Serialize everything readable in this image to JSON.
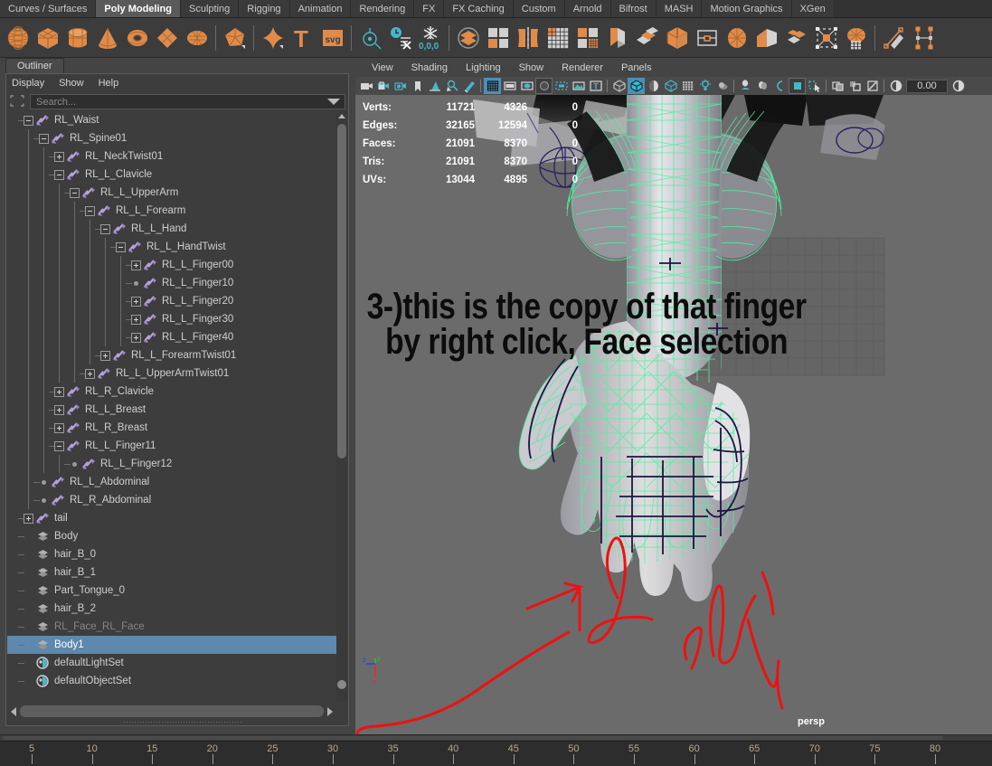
{
  "shelf_tabs": [
    {
      "label": "Curves / Surfaces",
      "active": false
    },
    {
      "label": "Poly Modeling",
      "active": true
    },
    {
      "label": "Sculpting",
      "active": false
    },
    {
      "label": "Rigging",
      "active": false
    },
    {
      "label": "Animation",
      "active": false
    },
    {
      "label": "Rendering",
      "active": false
    },
    {
      "label": "FX",
      "active": false
    },
    {
      "label": "FX Caching",
      "active": false
    },
    {
      "label": "Custom",
      "active": false
    },
    {
      "label": "Arnold",
      "active": false
    },
    {
      "label": "Bifrost",
      "active": false
    },
    {
      "label": "MASH",
      "active": false
    },
    {
      "label": "Motion Graphics",
      "active": false
    },
    {
      "label": "XGen",
      "active": false
    }
  ],
  "shelf_icons": [
    {
      "name": "poly-sphere-icon"
    },
    {
      "name": "poly-cube-icon"
    },
    {
      "name": "poly-cylinder-icon"
    },
    {
      "name": "poly-cone-icon"
    },
    {
      "name": "poly-torus-icon"
    },
    {
      "name": "poly-plane-icon"
    },
    {
      "name": "poly-disc-icon"
    },
    {
      "sep": true
    },
    {
      "name": "poly-platonic-icon"
    },
    {
      "sep": true
    },
    {
      "name": "poly-super-shape-icon"
    },
    {
      "name": "poly-type-text-icon"
    },
    {
      "name": "poly-svg-icon"
    },
    {
      "sep": true
    },
    {
      "name": "sculpt-target-icon"
    },
    {
      "name": "history-clock-icon"
    },
    {
      "name": "freeze-transform-icon"
    },
    {
      "sep": true
    },
    {
      "name": "combine-icon"
    },
    {
      "name": "separate-icon"
    },
    {
      "name": "mirror-icon"
    },
    {
      "name": "smooth-icon"
    },
    {
      "name": "retopologize-icon"
    },
    {
      "name": "extrude-icon"
    },
    {
      "name": "bevel-icon"
    },
    {
      "name": "bridge-icon"
    },
    {
      "name": "fill-hole-icon"
    },
    {
      "name": "circularize-icon"
    },
    {
      "name": "append-polygon-icon"
    },
    {
      "name": "merge-icon"
    },
    {
      "name": "target-weld-icon"
    },
    {
      "name": "multi-cut-icon"
    },
    {
      "sep": true
    },
    {
      "name": "knife-cut-icon"
    },
    {
      "name": "insert-edge-loop-icon"
    }
  ],
  "outliner": {
    "tab_label": "Outliner",
    "menus": [
      "Display",
      "Show",
      "Help"
    ],
    "search_placeholder": "Search...",
    "tree": [
      {
        "label": "RL_Waist",
        "depth": 1,
        "icon": "joint",
        "state": "minus"
      },
      {
        "label": "RL_Spine01",
        "depth": 2,
        "icon": "joint",
        "state": "minus"
      },
      {
        "label": "RL_NeckTwist01",
        "depth": 3,
        "icon": "joint",
        "state": "plus"
      },
      {
        "label": "RL_L_Clavicle",
        "depth": 3,
        "icon": "joint",
        "state": "minus"
      },
      {
        "label": "RL_L_UpperArm",
        "depth": 4,
        "icon": "joint",
        "state": "minus"
      },
      {
        "label": "RL_L_Forearm",
        "depth": 5,
        "icon": "joint",
        "state": "minus"
      },
      {
        "label": "RL_L_Hand",
        "depth": 6,
        "icon": "joint",
        "state": "minus"
      },
      {
        "label": "RL_L_HandTwist",
        "depth": 7,
        "icon": "joint",
        "state": "minus"
      },
      {
        "label": "RL_L_Finger00",
        "depth": 8,
        "icon": "joint",
        "state": "plus"
      },
      {
        "label": "RL_L_Finger10",
        "depth": 8,
        "icon": "joint",
        "state": "leaf"
      },
      {
        "label": "RL_L_Finger20",
        "depth": 8,
        "icon": "joint",
        "state": "plus"
      },
      {
        "label": "RL_L_Finger30",
        "depth": 8,
        "icon": "joint",
        "state": "plus"
      },
      {
        "label": "RL_L_Finger40",
        "depth": 8,
        "icon": "joint",
        "state": "plus"
      },
      {
        "label": "RL_L_ForearmTwist01",
        "depth": 6,
        "icon": "joint",
        "state": "plus"
      },
      {
        "label": "RL_L_UpperArmTwist01",
        "depth": 5,
        "icon": "joint",
        "state": "plus"
      },
      {
        "label": "RL_R_Clavicle",
        "depth": 3,
        "icon": "joint",
        "state": "plus"
      },
      {
        "label": "RL_L_Breast",
        "depth": 3,
        "icon": "joint",
        "state": "plus"
      },
      {
        "label": "RL_R_Breast",
        "depth": 3,
        "icon": "joint",
        "state": "plus"
      },
      {
        "label": "RL_L_Finger11",
        "depth": 3,
        "icon": "joint",
        "state": "minus"
      },
      {
        "label": "RL_L_Finger12",
        "depth": 4,
        "icon": "joint",
        "state": "leaf"
      },
      {
        "label": "RL_L_Abdominal",
        "depth": 2,
        "icon": "joint",
        "state": "leaf"
      },
      {
        "label": "RL_R_Abdominal",
        "depth": 2,
        "icon": "joint",
        "state": "leaf"
      },
      {
        "label": "tail",
        "depth": 1,
        "icon": "joint",
        "state": "plus"
      },
      {
        "label": "Body",
        "depth": 1,
        "icon": "mesh",
        "state": "none"
      },
      {
        "label": "hair_B_0",
        "depth": 1,
        "icon": "mesh",
        "state": "none"
      },
      {
        "label": "hair_B_1",
        "depth": 1,
        "icon": "mesh",
        "state": "none"
      },
      {
        "label": "Part_Tongue_0",
        "depth": 1,
        "icon": "mesh",
        "state": "none"
      },
      {
        "label": "hair_B_2",
        "depth": 1,
        "icon": "mesh",
        "state": "none"
      },
      {
        "label": "RL_Face_RL_Face",
        "depth": 1,
        "icon": "mesh",
        "state": "none",
        "dim": true
      },
      {
        "label": "Body1",
        "depth": 1,
        "icon": "mesh",
        "state": "none",
        "selected": true
      },
      {
        "label": "defaultLightSet",
        "depth": 1,
        "icon": "set",
        "state": "none"
      },
      {
        "label": "defaultObjectSet",
        "depth": 1,
        "icon": "set",
        "state": "none"
      }
    ]
  },
  "viewport": {
    "menus": [
      "View",
      "Shading",
      "Lighting",
      "Show",
      "Renderer",
      "Panels"
    ],
    "toolbar_icons": [
      {
        "name": "camera-icon"
      },
      {
        "name": "camera-lock-icon"
      },
      {
        "name": "camera-attributes-icon"
      },
      {
        "name": "bookmark-icon"
      },
      {
        "name": "image-plane-icon"
      },
      {
        "name": "two-d-pan-zoom-icon"
      },
      {
        "name": "grease-pencil-icon"
      },
      {
        "sep": true
      },
      {
        "name": "grid-toggle-icon",
        "on": true
      },
      {
        "name": "film-gate-icon"
      },
      {
        "name": "resolution-gate-icon"
      },
      {
        "name": "gate-mask-icon",
        "box": true
      },
      {
        "name": "field-chart-icon"
      },
      {
        "name": "safe-action-icon"
      },
      {
        "name": "hud-text-icon"
      },
      {
        "sep": true
      },
      {
        "name": "wireframe-shading-icon"
      },
      {
        "name": "smooth-shade-all-icon",
        "on": true
      },
      {
        "name": "smooth-shade-selected-icon"
      },
      {
        "name": "flat-shade-icon"
      },
      {
        "name": "bounding-box-icon"
      },
      {
        "name": "use-default-light-icon"
      },
      {
        "name": "shadows-icon"
      },
      {
        "sep": true
      },
      {
        "name": "ambient-occlusion-icon"
      },
      {
        "name": "motion-blur-icon"
      },
      {
        "name": "multisample-icon"
      },
      {
        "name": "depth-of-field-icon",
        "box": true
      },
      {
        "name": "isolate-select-icon"
      },
      {
        "sep": true
      },
      {
        "name": "xray-icon"
      },
      {
        "name": "xray-joints-icon"
      },
      {
        "name": "xray-active-icon"
      },
      {
        "sep": true
      },
      {
        "name": "exposure-icon"
      }
    ],
    "exposure_value": "0.00",
    "camera_label": "persp",
    "axis_labels": {
      "x": "x",
      "y": "y",
      "z": "z"
    },
    "axis_colors": {
      "x": "#ff2020",
      "y": "#20d020",
      "z": "#2040ff"
    },
    "hud": {
      "rows": [
        {
          "label": "Verts:",
          "total": "11721",
          "selected": "4326",
          "extra": "0"
        },
        {
          "label": "Edges:",
          "total": "32165",
          "selected": "12594",
          "extra": "0"
        },
        {
          "label": "Faces:",
          "total": "21091",
          "selected": "8370",
          "extra": "0"
        },
        {
          "label": "Tris:",
          "total": "21091",
          "selected": "8370",
          "extra": "0"
        },
        {
          "label": "UVs:",
          "total": "13044",
          "selected": "4895",
          "extra": "0"
        }
      ]
    },
    "annotation": {
      "line1": "3-)this is the copy of that finger",
      "line2": "by right click, Face selection",
      "color": "#0c0c0c",
      "scribble_color": "#ee1111"
    }
  },
  "timeline": {
    "ticks": [
      "5",
      "10",
      "15",
      "20",
      "25",
      "30",
      "35",
      "40",
      "45",
      "50",
      "55",
      "60",
      "65",
      "70",
      "75",
      "80"
    ]
  },
  "colors": {
    "shelf_bg": "#3c3c3c",
    "tab_active": "#5a5a5a",
    "panel_bg": "#3d3d3d",
    "selection_blue": "#5e88ad",
    "accent_orange": "#e08b4a",
    "accent_cyan": "#4d8fb5",
    "joint_purple": "#b4a0d8",
    "viewport_bg": "#6b6b6b",
    "wireframe_green": "#4ff0a0"
  }
}
